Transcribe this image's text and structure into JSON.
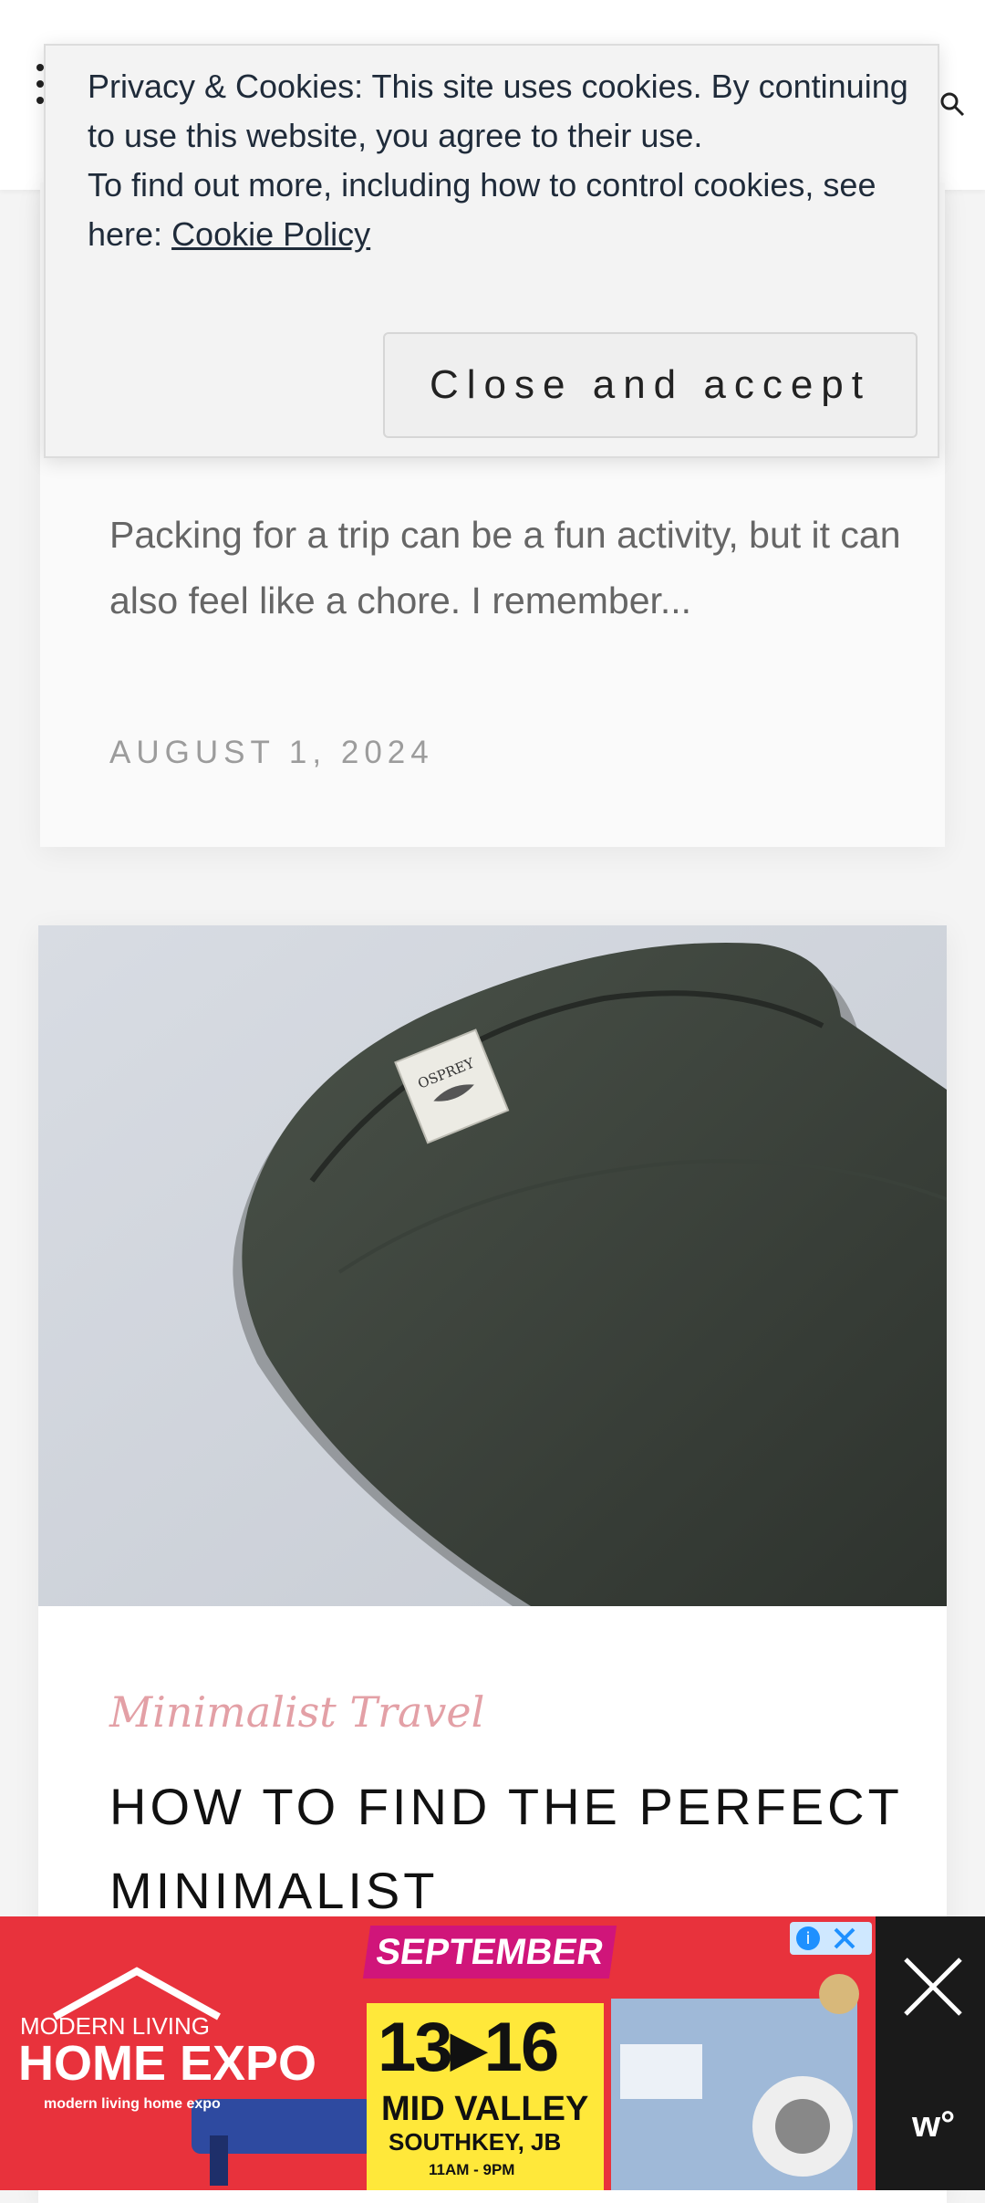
{
  "cookie_banner": {
    "line1": "Privacy & Cookies: This site uses cookies. By continuing to use this website, you agree to their use.",
    "line2_prefix": "To find out more, including how to control cookies, see here: ",
    "policy_link": "Cookie Policy",
    "accept_button": "Close and accept"
  },
  "post1": {
    "excerpt": "Packing for a trip can be a fun activity, but it can also feel like a chore. I remember...",
    "date": "AUGUST 1, 2024"
  },
  "post2": {
    "category": "Minimalist Travel",
    "title": "HOW TO FIND THE PERFECT MINIMALIST",
    "image_alt": "Osprey backpack",
    "image_logo": "OSPREY"
  },
  "ad": {
    "brand_top": "MODERN LIVING",
    "brand_main": "HOME EXPO",
    "brand_sub": "modern living home expo",
    "month": "SEPTEMBER",
    "dates": "13▸16",
    "venue": "MID VALLEY",
    "location": "SOUTHKEY, JB",
    "hours": "11AM - 9PM"
  },
  "colors": {
    "accent_pink": "#e3a0a6",
    "ad_red": "#e8323c",
    "cookie_text": "#1f2b3a"
  }
}
